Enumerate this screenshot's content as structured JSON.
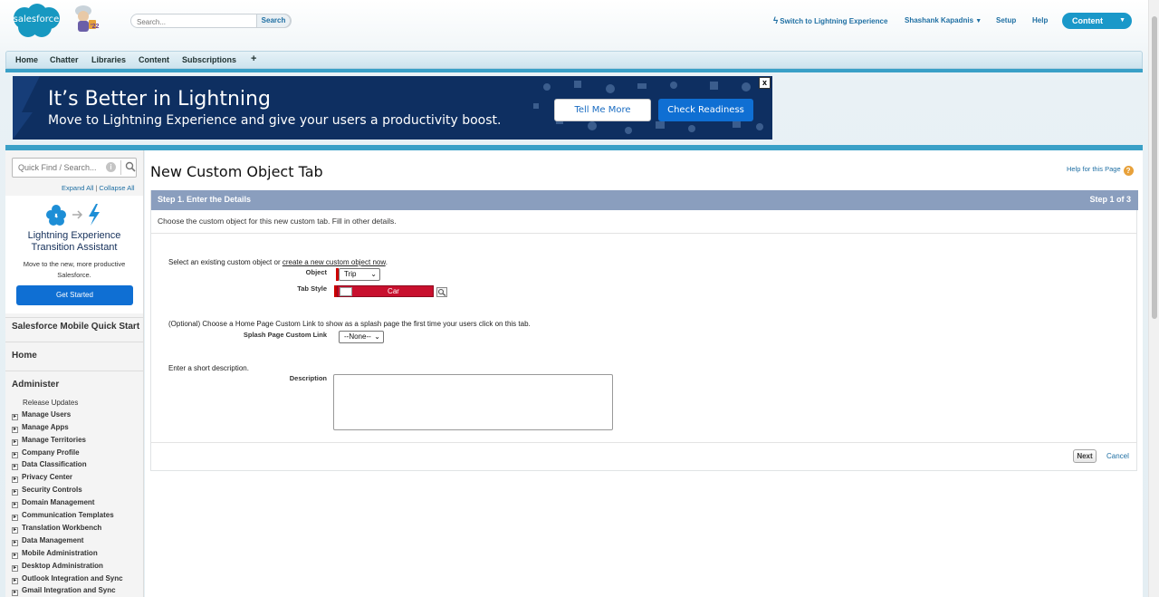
{
  "header": {
    "logo_text": "salesforce",
    "mascot_year": "'22",
    "search_placeholder": "Search...",
    "search_button": "Search",
    "switch_link": "Switch to Lightning Experience",
    "user_name": "Shashank Kapadnis",
    "setup": "Setup",
    "help": "Help",
    "app_menu": "Content"
  },
  "tabs": [
    "Home",
    "Chatter",
    "Libraries",
    "Content",
    "Subscriptions",
    "+"
  ],
  "banner": {
    "title": "It’s Better in Lightning",
    "subtitle": "Move to Lightning Experience and give your users a productivity boost.",
    "tell_me_more": "Tell Me More",
    "check_readiness": "Check Readiness",
    "close": "x"
  },
  "sidebar": {
    "quick_find_placeholder": "Quick Find / Search...",
    "info": "i",
    "expand_all": "Expand All",
    "collapse_all": "Collapse All",
    "separator": "|",
    "lea_title": "Lightning Experience Transition Assistant",
    "lea_desc": "Move to the new, more productive Salesforce.",
    "get_started": "Get Started",
    "mobile_quick_start": "Salesforce Mobile Quick Start",
    "home": "Home",
    "administer": "Administer",
    "release_updates": "Release Updates",
    "admin_items": [
      "Manage Users",
      "Manage Apps",
      "Manage Territories",
      "Company Profile",
      "Data Classification",
      "Privacy Center",
      "Security Controls",
      "Domain Management",
      "Communication Templates",
      "Translation Workbench",
      "Data Management",
      "Mobile Administration",
      "Desktop Administration",
      "Outlook Integration and Sync",
      "Gmail Integration and Sync"
    ]
  },
  "main": {
    "page_title": "New Custom Object Tab",
    "help_link": "Help for this Page",
    "step_title": "Step 1. Enter the Details",
    "step_count": "Step 1 of 3",
    "step_desc": "Choose the custom object for this new custom tab. Fill in other details.",
    "select_text": "Select an existing custom object or ",
    "create_link": "create a new custom object now",
    "select_text_end": ".",
    "object_label": "Object",
    "object_value": "Trip",
    "tab_style_label": "Tab Style",
    "tab_style_value": "Car",
    "optional_text": "(Optional) Choose a Home Page Custom Link to show as a splash page the first time your users click on this tab.",
    "splash_label": "Splash Page Custom Link",
    "splash_value": "--None--",
    "short_desc_text": "Enter a short description.",
    "description_label": "Description",
    "description_value": "",
    "next_button": "Next",
    "cancel_link": "Cancel"
  },
  "colors": {
    "accent": "#1a98c9",
    "step_header": "#8a9ebe",
    "banner_bg": "#0e2f61",
    "lightning_button": "#0f6fd3",
    "tab_style": "#c8102e"
  }
}
